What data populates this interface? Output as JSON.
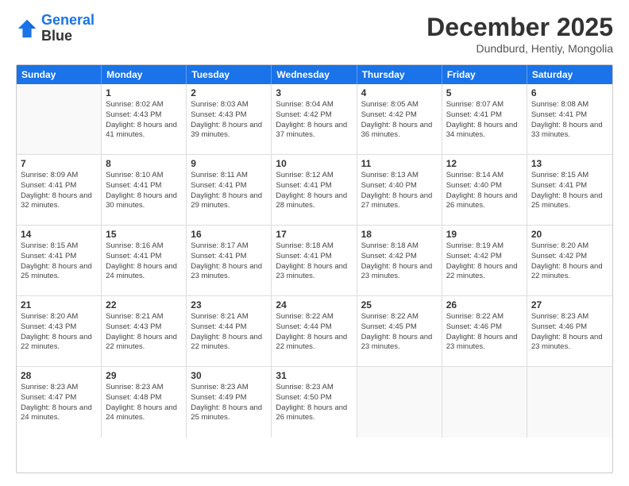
{
  "logo": {
    "line1": "General",
    "line2": "Blue"
  },
  "header": {
    "month_year": "December 2025",
    "location": "Dundburd, Hentiy, Mongolia"
  },
  "weekdays": [
    "Sunday",
    "Monday",
    "Tuesday",
    "Wednesday",
    "Thursday",
    "Friday",
    "Saturday"
  ],
  "weeks": [
    [
      {
        "day": "",
        "sunrise": "",
        "sunset": "",
        "daylight": ""
      },
      {
        "day": "1",
        "sunrise": "Sunrise: 8:02 AM",
        "sunset": "Sunset: 4:43 PM",
        "daylight": "Daylight: 8 hours and 41 minutes."
      },
      {
        "day": "2",
        "sunrise": "Sunrise: 8:03 AM",
        "sunset": "Sunset: 4:43 PM",
        "daylight": "Daylight: 8 hours and 39 minutes."
      },
      {
        "day": "3",
        "sunrise": "Sunrise: 8:04 AM",
        "sunset": "Sunset: 4:42 PM",
        "daylight": "Daylight: 8 hours and 37 minutes."
      },
      {
        "day": "4",
        "sunrise": "Sunrise: 8:05 AM",
        "sunset": "Sunset: 4:42 PM",
        "daylight": "Daylight: 8 hours and 36 minutes."
      },
      {
        "day": "5",
        "sunrise": "Sunrise: 8:07 AM",
        "sunset": "Sunset: 4:41 PM",
        "daylight": "Daylight: 8 hours and 34 minutes."
      },
      {
        "day": "6",
        "sunrise": "Sunrise: 8:08 AM",
        "sunset": "Sunset: 4:41 PM",
        "daylight": "Daylight: 8 hours and 33 minutes."
      }
    ],
    [
      {
        "day": "7",
        "sunrise": "Sunrise: 8:09 AM",
        "sunset": "Sunset: 4:41 PM",
        "daylight": "Daylight: 8 hours and 32 minutes."
      },
      {
        "day": "8",
        "sunrise": "Sunrise: 8:10 AM",
        "sunset": "Sunset: 4:41 PM",
        "daylight": "Daylight: 8 hours and 30 minutes."
      },
      {
        "day": "9",
        "sunrise": "Sunrise: 8:11 AM",
        "sunset": "Sunset: 4:41 PM",
        "daylight": "Daylight: 8 hours and 29 minutes."
      },
      {
        "day": "10",
        "sunrise": "Sunrise: 8:12 AM",
        "sunset": "Sunset: 4:41 PM",
        "daylight": "Daylight: 8 hours and 28 minutes."
      },
      {
        "day": "11",
        "sunrise": "Sunrise: 8:13 AM",
        "sunset": "Sunset: 4:40 PM",
        "daylight": "Daylight: 8 hours and 27 minutes."
      },
      {
        "day": "12",
        "sunrise": "Sunrise: 8:14 AM",
        "sunset": "Sunset: 4:40 PM",
        "daylight": "Daylight: 8 hours and 26 minutes."
      },
      {
        "day": "13",
        "sunrise": "Sunrise: 8:15 AM",
        "sunset": "Sunset: 4:41 PM",
        "daylight": "Daylight: 8 hours and 25 minutes."
      }
    ],
    [
      {
        "day": "14",
        "sunrise": "Sunrise: 8:15 AM",
        "sunset": "Sunset: 4:41 PM",
        "daylight": "Daylight: 8 hours and 25 minutes."
      },
      {
        "day": "15",
        "sunrise": "Sunrise: 8:16 AM",
        "sunset": "Sunset: 4:41 PM",
        "daylight": "Daylight: 8 hours and 24 minutes."
      },
      {
        "day": "16",
        "sunrise": "Sunrise: 8:17 AM",
        "sunset": "Sunset: 4:41 PM",
        "daylight": "Daylight: 8 hours and 23 minutes."
      },
      {
        "day": "17",
        "sunrise": "Sunrise: 8:18 AM",
        "sunset": "Sunset: 4:41 PM",
        "daylight": "Daylight: 8 hours and 23 minutes."
      },
      {
        "day": "18",
        "sunrise": "Sunrise: 8:18 AM",
        "sunset": "Sunset: 4:42 PM",
        "daylight": "Daylight: 8 hours and 23 minutes."
      },
      {
        "day": "19",
        "sunrise": "Sunrise: 8:19 AM",
        "sunset": "Sunset: 4:42 PM",
        "daylight": "Daylight: 8 hours and 22 minutes."
      },
      {
        "day": "20",
        "sunrise": "Sunrise: 8:20 AM",
        "sunset": "Sunset: 4:42 PM",
        "daylight": "Daylight: 8 hours and 22 minutes."
      }
    ],
    [
      {
        "day": "21",
        "sunrise": "Sunrise: 8:20 AM",
        "sunset": "Sunset: 4:43 PM",
        "daylight": "Daylight: 8 hours and 22 minutes."
      },
      {
        "day": "22",
        "sunrise": "Sunrise: 8:21 AM",
        "sunset": "Sunset: 4:43 PM",
        "daylight": "Daylight: 8 hours and 22 minutes."
      },
      {
        "day": "23",
        "sunrise": "Sunrise: 8:21 AM",
        "sunset": "Sunset: 4:44 PM",
        "daylight": "Daylight: 8 hours and 22 minutes."
      },
      {
        "day": "24",
        "sunrise": "Sunrise: 8:22 AM",
        "sunset": "Sunset: 4:44 PM",
        "daylight": "Daylight: 8 hours and 22 minutes."
      },
      {
        "day": "25",
        "sunrise": "Sunrise: 8:22 AM",
        "sunset": "Sunset: 4:45 PM",
        "daylight": "Daylight: 8 hours and 23 minutes."
      },
      {
        "day": "26",
        "sunrise": "Sunrise: 8:22 AM",
        "sunset": "Sunset: 4:46 PM",
        "daylight": "Daylight: 8 hours and 23 minutes."
      },
      {
        "day": "27",
        "sunrise": "Sunrise: 8:23 AM",
        "sunset": "Sunset: 4:46 PM",
        "daylight": "Daylight: 8 hours and 23 minutes."
      }
    ],
    [
      {
        "day": "28",
        "sunrise": "Sunrise: 8:23 AM",
        "sunset": "Sunset: 4:47 PM",
        "daylight": "Daylight: 8 hours and 24 minutes."
      },
      {
        "day": "29",
        "sunrise": "Sunrise: 8:23 AM",
        "sunset": "Sunset: 4:48 PM",
        "daylight": "Daylight: 8 hours and 24 minutes."
      },
      {
        "day": "30",
        "sunrise": "Sunrise: 8:23 AM",
        "sunset": "Sunset: 4:49 PM",
        "daylight": "Daylight: 8 hours and 25 minutes."
      },
      {
        "day": "31",
        "sunrise": "Sunrise: 8:23 AM",
        "sunset": "Sunset: 4:50 PM",
        "daylight": "Daylight: 8 hours and 26 minutes."
      },
      {
        "day": "",
        "sunrise": "",
        "sunset": "",
        "daylight": ""
      },
      {
        "day": "",
        "sunrise": "",
        "sunset": "",
        "daylight": ""
      },
      {
        "day": "",
        "sunrise": "",
        "sunset": "",
        "daylight": ""
      }
    ]
  ]
}
